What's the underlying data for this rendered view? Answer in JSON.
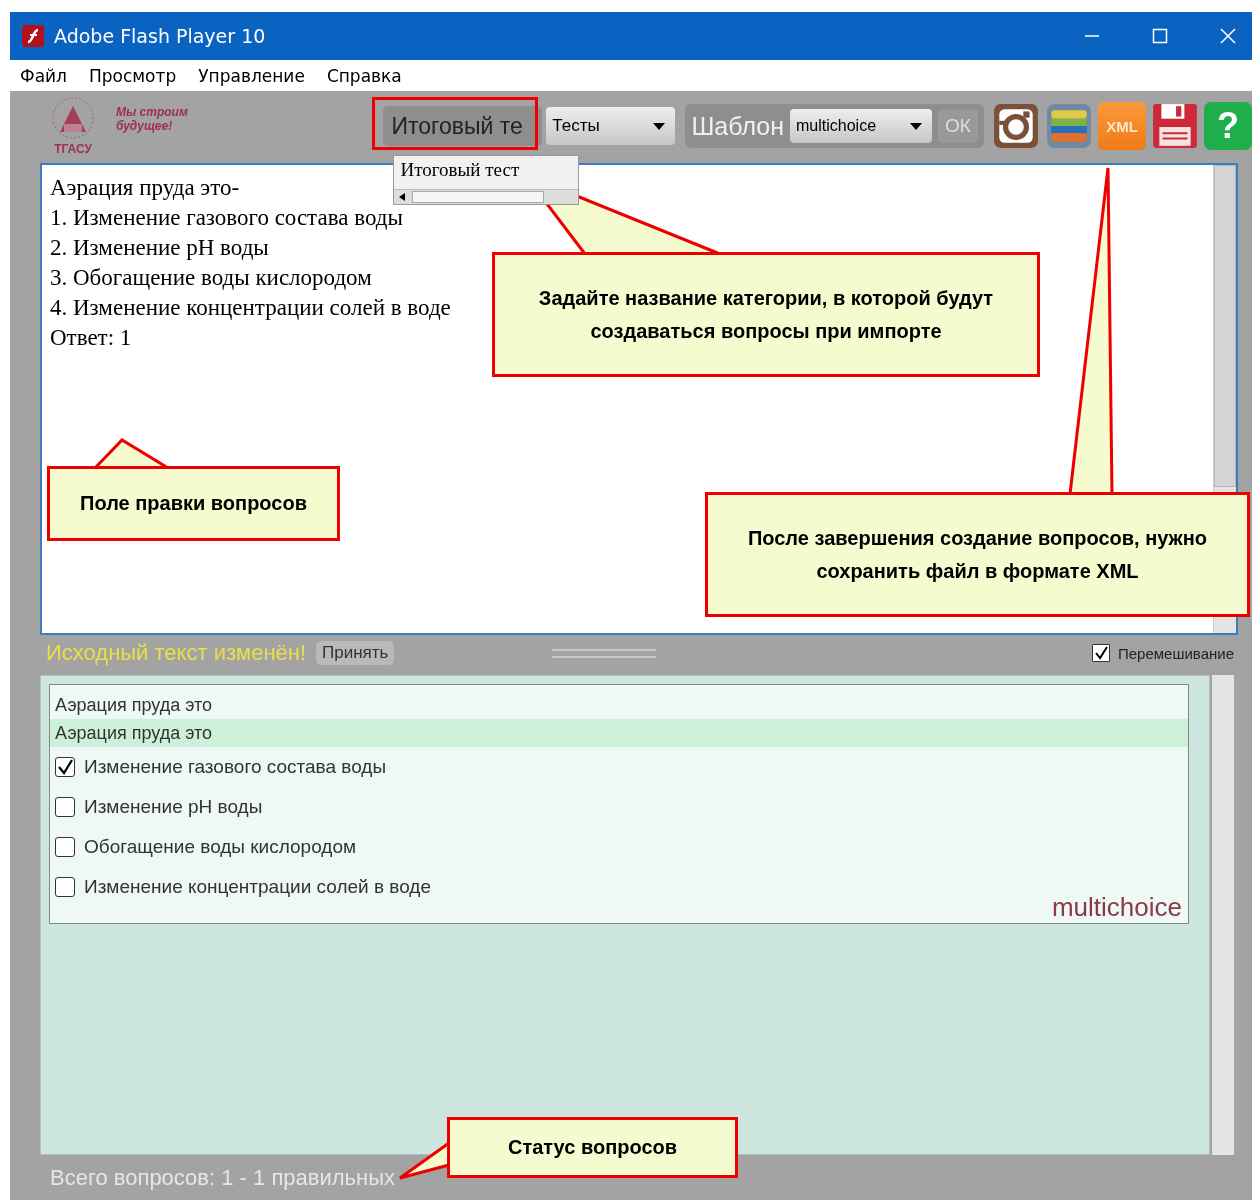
{
  "window": {
    "title": "Adobe Flash Player 10"
  },
  "menu": [
    "Файл",
    "Просмотр",
    "Управление",
    "Справка"
  ],
  "logo": {
    "slogan": [
      "Мы строим",
      "будущее!"
    ],
    "name": "ТГАСУ"
  },
  "toolbar": {
    "category_field": {
      "value": "Итоговый те"
    },
    "category_dropdown": {
      "expanded": true,
      "options": [
        "Итоговый тест"
      ]
    },
    "tests_select": "Тесты",
    "template_label": "Шаблон",
    "template_select": "multichoice",
    "ok_button": "ОК",
    "tools": [
      {
        "kind": "camera"
      },
      {
        "kind": "layers"
      },
      {
        "kind": "xml",
        "label": "XML"
      },
      {
        "kind": "save"
      },
      {
        "kind": "help",
        "label": "?"
      }
    ]
  },
  "editor": {
    "lines": [
      "Аэрация пруда это-",
      "1. Изменение газового состава воды",
      "2. Изменение pH воды",
      "3. Обогащение воды кислородом",
      "4. Изменение концентрации солей в воде",
      "Ответ: 1"
    ]
  },
  "status_row": {
    "message": "Исходный текст изменён!",
    "accept_button": "Принять",
    "shuffle": {
      "label": "Перемешивание",
      "checked": true
    }
  },
  "preview": {
    "question": "Аэрация пруда это",
    "highlighted_question": "Аэрация пруда это",
    "options": [
      {
        "label": "Изменение газового состава воды",
        "checked": true
      },
      {
        "label": "Изменение pH воды",
        "checked": false
      },
      {
        "label": "Обогащение воды кислородом",
        "checked": false
      },
      {
        "label": "Изменение концентрации солей в воде",
        "checked": false
      }
    ],
    "type_label": "multichoice"
  },
  "status_bar": "Всего вопросов: 1 - 1 правильных",
  "callouts": [
    {
      "kind": "category",
      "text": "Задайте название категории, в которой будут создаваться вопросы при импорте"
    },
    {
      "kind": "editor",
      "text": "Поле правки вопросов"
    },
    {
      "kind": "save",
      "text": "После завершения создание вопросов, нужно сохранить файл в формате XML"
    },
    {
      "kind": "status",
      "text": "Статус вопросов"
    }
  ]
}
